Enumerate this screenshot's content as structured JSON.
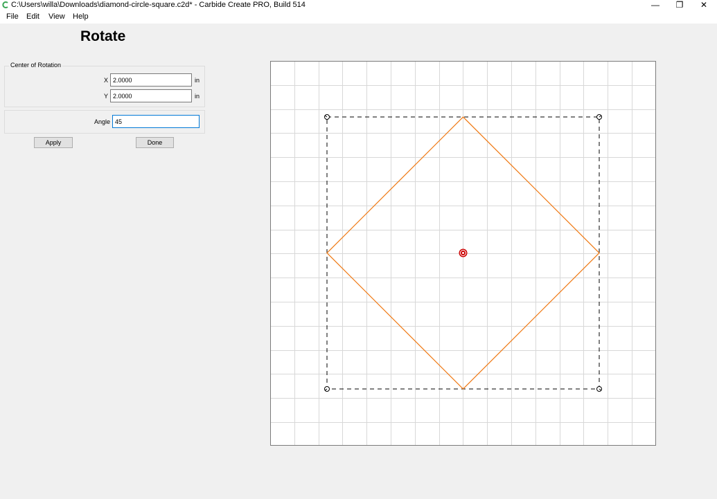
{
  "window": {
    "title": "C:\\Users\\willa\\Downloads\\diamond-circle-square.c2d* - Carbide Create PRO, Build 514",
    "minimize_glyph": "—",
    "restore_glyph": "❐",
    "close_glyph": "✕"
  },
  "menu": {
    "file": "File",
    "edit": "Edit",
    "view": "View",
    "help": "Help"
  },
  "panel": {
    "title": "Rotate",
    "center_group_label": "Center of Rotation",
    "x_label": "X",
    "x_value": "2.0000",
    "x_unit": "in",
    "y_label": "Y",
    "y_value": "2.0000",
    "y_unit": "in",
    "angle_label": "Angle",
    "angle_value": "45",
    "apply_label": "Apply",
    "done_label": "Done"
  },
  "colors": {
    "accent": "#0078d7",
    "shape_stroke": "#f07f1e",
    "grid": "#d8d8d8",
    "center_marker": "#cc0000",
    "app_icon": "#3aa655"
  },
  "icons": {
    "app": "carbide-create-icon",
    "center": "rotation-center-icon",
    "corners": "rotate-handle-icon"
  }
}
